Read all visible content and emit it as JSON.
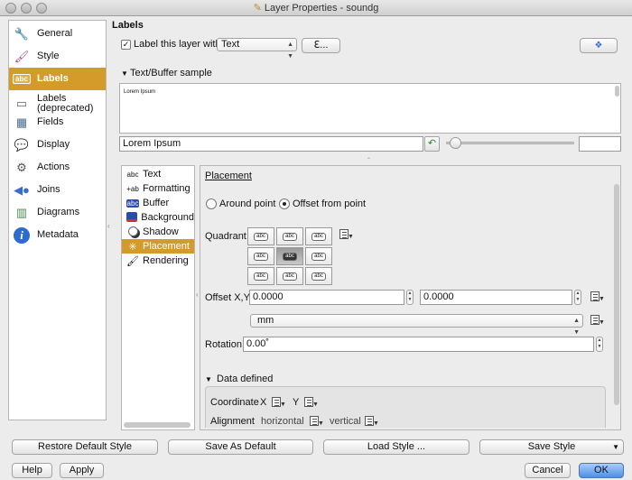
{
  "window": {
    "title": "Layer Properties - soundg"
  },
  "sidebar": {
    "items": [
      {
        "label": "General",
        "icon": "wrench-screwdriver-icon"
      },
      {
        "label": "Style",
        "icon": "paintbrush-icon"
      },
      {
        "label": "Labels",
        "icon": "abc-label-icon",
        "selected": true
      },
      {
        "label": "Labels\n(deprecated)",
        "icon": "labels-deprecated-icon"
      },
      {
        "label": "Fields",
        "icon": "fields-table-icon"
      },
      {
        "label": "Display",
        "icon": "speech-bubble-icon"
      },
      {
        "label": "Actions",
        "icon": "gear-icon"
      },
      {
        "label": "Joins",
        "icon": "joins-icon"
      },
      {
        "label": "Diagrams",
        "icon": "diagrams-icon"
      },
      {
        "label": "Metadata",
        "icon": "info-icon"
      }
    ]
  },
  "labels": {
    "heading": "Labels",
    "label_with": "Label this layer with",
    "label_with_checked": true,
    "field_combo": "Text",
    "expression_button": "ℇ...",
    "sample_section": "Text/Buffer sample",
    "sample_text": "Lorem Ipsum",
    "sample_input": "Lorem Ipsum"
  },
  "subnav": {
    "items": [
      {
        "label": "Text",
        "icon": "text-abc-icon"
      },
      {
        "label": "Formatting",
        "icon": "formatting-icon"
      },
      {
        "label": "Buffer",
        "icon": "buffer-icon"
      },
      {
        "label": "Background",
        "icon": "background-icon"
      },
      {
        "label": "Shadow",
        "icon": "shadow-icon"
      },
      {
        "label": "Placement",
        "icon": "placement-icon",
        "selected": true
      },
      {
        "label": "Rendering",
        "icon": "rendering-brush-icon"
      }
    ]
  },
  "placement": {
    "title": "Placement",
    "around_point": "Around point",
    "offset_from_point": "Offset from point",
    "selected_mode": "offset_from_point",
    "quadrant_label": "Quadrant",
    "quadrant_cell_text": "abc",
    "quadrant_selected": 4,
    "offset_label": "Offset X,Y",
    "offset_x": "0.0000",
    "offset_y": "0.0000",
    "unit": "mm",
    "rotation_label": "Rotation",
    "rotation": "0.00˚",
    "data_defined": "Data defined",
    "coordinate_label": "Coordinate",
    "coord_x": "X",
    "coord_y": "Y",
    "alignment_label": "Alignment",
    "horizontal": "horizontal",
    "vertical": "vertical"
  },
  "bottom": {
    "restore": "Restore Default Style",
    "save_default": "Save As Default",
    "load_style": "Load Style ...",
    "save_style": "Save Style",
    "help": "Help",
    "apply": "Apply",
    "cancel": "Cancel",
    "ok": "OK"
  },
  "colors": {
    "selection": "#d49a2a",
    "ok_button": "#4d8fe6"
  }
}
